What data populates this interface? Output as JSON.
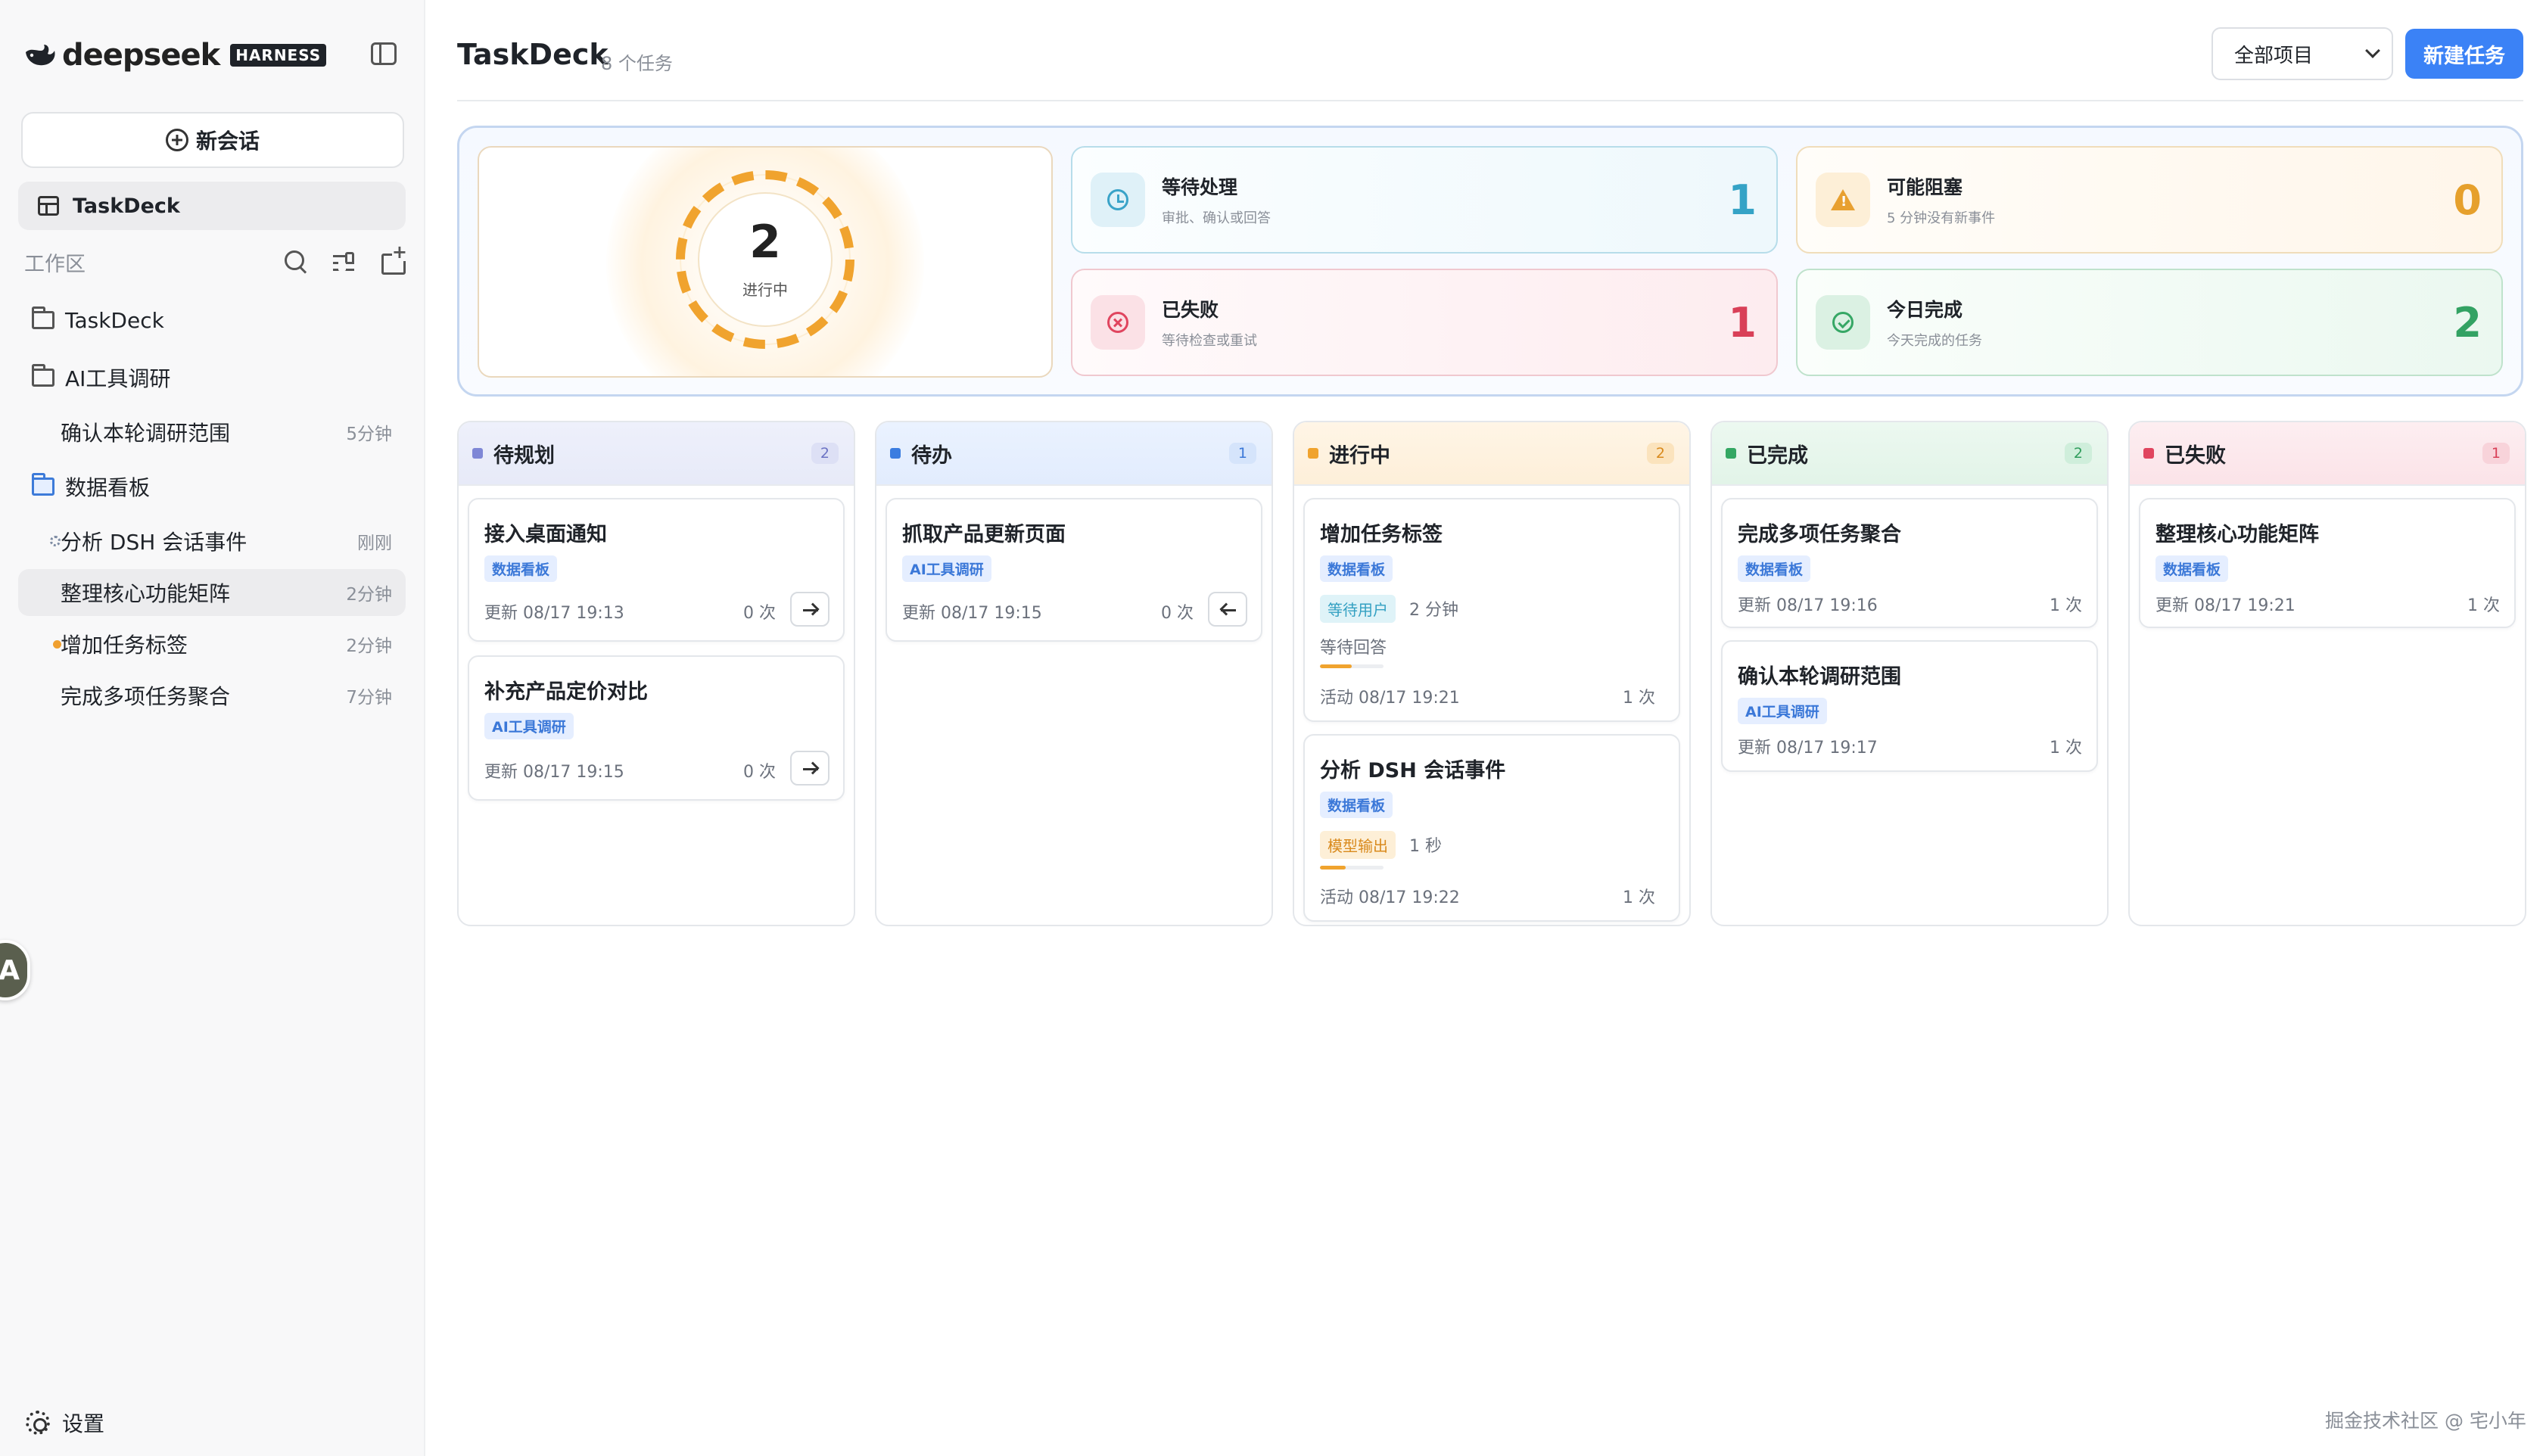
{
  "brand": {
    "name": "deepseek",
    "tag": "HARNESS"
  },
  "sidebar": {
    "new_chat": "新会话",
    "nav": {
      "label": "TaskDeck"
    },
    "workspace_label": "工作区",
    "tree": [
      {
        "type": "folder",
        "label": "TaskDeck",
        "time": ""
      },
      {
        "type": "folder-open",
        "label": "AI工具调研",
        "time": ""
      },
      {
        "type": "child",
        "label": "确认本轮调研范围",
        "time": "5分钟"
      },
      {
        "type": "folder-blue",
        "label": "数据看板",
        "time": ""
      },
      {
        "type": "child-spinner",
        "label": "分析 DSH 会话事件",
        "time": "刚刚"
      },
      {
        "type": "child-active",
        "label": "整理核心功能矩阵",
        "time": "2分钟"
      },
      {
        "type": "child-dot",
        "label": "增加任务标签",
        "time": "2分钟"
      },
      {
        "type": "child",
        "label": "完成多项任务聚合",
        "time": "7分钟"
      }
    ],
    "settings": "设置",
    "avatar_letter": "A"
  },
  "header": {
    "title": "TaskDeck",
    "subtitle": "8 个任务",
    "project_select": "全部项目",
    "new_task": "新建任务"
  },
  "summary": {
    "ring": {
      "value": "2",
      "label": "进行中"
    },
    "stats": [
      {
        "key": "wait",
        "title": "等待处理",
        "desc": "审批、确认或回答",
        "value": "1",
        "icon": "clock-icon"
      },
      {
        "key": "block",
        "title": "可能阻塞",
        "desc": "5 分钟没有新事件",
        "value": "0",
        "icon": "warning-icon"
      },
      {
        "key": "fail",
        "title": "已失败",
        "desc": "等待检查或重试",
        "value": "1",
        "icon": "x-circle-icon"
      },
      {
        "key": "done",
        "title": "今日完成",
        "desc": "今天完成的任务",
        "value": "2",
        "icon": "check-circle-icon"
      }
    ]
  },
  "board": {
    "columns": [
      {
        "key": "plan",
        "title": "待规划",
        "count": "2",
        "cards": [
          {
            "title": "接入桌面通知",
            "tag": "数据看板",
            "meta": "更新 08/17 19:13",
            "count": "0 次",
            "arrow": "right"
          },
          {
            "title": "补充产品定价对比",
            "tag": "AI工具调研",
            "meta": "更新 08/17 19:15",
            "count": "0 次",
            "arrow": "right"
          }
        ]
      },
      {
        "key": "todo",
        "title": "待办",
        "count": "1",
        "cards": [
          {
            "title": "抓取产品更新页面",
            "tag": "AI工具调研",
            "meta": "更新 08/17 19:15",
            "count": "0 次",
            "arrow": "left"
          }
        ]
      },
      {
        "key": "doing",
        "title": "进行中",
        "count": "2",
        "cards": [
          {
            "title": "增加任务标签",
            "tag": "数据看板",
            "status": "等待用户",
            "duration": "2 分钟",
            "note": "等待回答",
            "progress": 0.5,
            "meta": "活动 08/17 19:21",
            "count": "1 次"
          },
          {
            "title": "分析 DSH 会话事件",
            "tag": "数据看板",
            "status": "模型输出",
            "duration": "1 秒",
            "note": "",
            "progress": 0.4,
            "meta": "活动 08/17 19:22",
            "count": "1 次"
          }
        ]
      },
      {
        "key": "done",
        "title": "已完成",
        "count": "2",
        "cards": [
          {
            "title": "完成多项任务聚合",
            "tag": "数据看板",
            "meta": "更新 08/17 19:16",
            "count": "1 次"
          },
          {
            "title": "确认本轮调研范围",
            "tag": "AI工具调研",
            "meta": "更新 08/17 19:17",
            "count": "1 次"
          }
        ]
      },
      {
        "key": "fail",
        "title": "已失败",
        "count": "1",
        "cards": [
          {
            "title": "整理核心功能矩阵",
            "tag": "数据看板",
            "meta": "更新 08/17 19:21",
            "count": "1 次"
          }
        ]
      }
    ]
  },
  "watermark": "掘金技术社区 @ 宅小年",
  "colors": {
    "accent": "#3b82f6",
    "in_progress": "#f0a32e",
    "failed": "#e0455f",
    "done": "#34a763",
    "waiting": "#35a3c6"
  }
}
